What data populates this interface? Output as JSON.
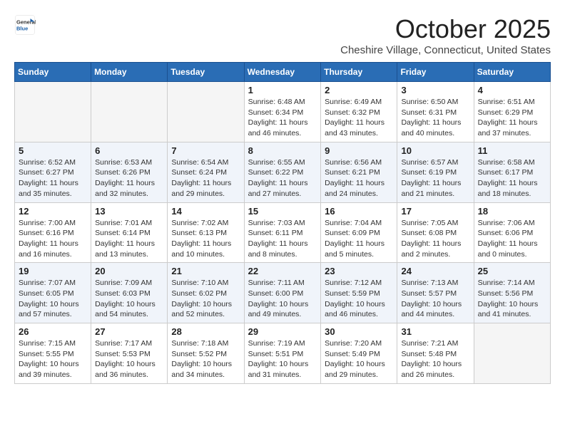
{
  "logo": {
    "line1": "General",
    "line2": "Blue"
  },
  "title": "October 2025",
  "subtitle": "Cheshire Village, Connecticut, United States",
  "days_of_week": [
    "Sunday",
    "Monday",
    "Tuesday",
    "Wednesday",
    "Thursday",
    "Friday",
    "Saturday"
  ],
  "weeks": [
    [
      {
        "day": "",
        "info": ""
      },
      {
        "day": "",
        "info": ""
      },
      {
        "day": "",
        "info": ""
      },
      {
        "day": "1",
        "info": "Sunrise: 6:48 AM\nSunset: 6:34 PM\nDaylight: 11 hours\nand 46 minutes."
      },
      {
        "day": "2",
        "info": "Sunrise: 6:49 AM\nSunset: 6:32 PM\nDaylight: 11 hours\nand 43 minutes."
      },
      {
        "day": "3",
        "info": "Sunrise: 6:50 AM\nSunset: 6:31 PM\nDaylight: 11 hours\nand 40 minutes."
      },
      {
        "day": "4",
        "info": "Sunrise: 6:51 AM\nSunset: 6:29 PM\nDaylight: 11 hours\nand 37 minutes."
      }
    ],
    [
      {
        "day": "5",
        "info": "Sunrise: 6:52 AM\nSunset: 6:27 PM\nDaylight: 11 hours\nand 35 minutes."
      },
      {
        "day": "6",
        "info": "Sunrise: 6:53 AM\nSunset: 6:26 PM\nDaylight: 11 hours\nand 32 minutes."
      },
      {
        "day": "7",
        "info": "Sunrise: 6:54 AM\nSunset: 6:24 PM\nDaylight: 11 hours\nand 29 minutes."
      },
      {
        "day": "8",
        "info": "Sunrise: 6:55 AM\nSunset: 6:22 PM\nDaylight: 11 hours\nand 27 minutes."
      },
      {
        "day": "9",
        "info": "Sunrise: 6:56 AM\nSunset: 6:21 PM\nDaylight: 11 hours\nand 24 minutes."
      },
      {
        "day": "10",
        "info": "Sunrise: 6:57 AM\nSunset: 6:19 PM\nDaylight: 11 hours\nand 21 minutes."
      },
      {
        "day": "11",
        "info": "Sunrise: 6:58 AM\nSunset: 6:17 PM\nDaylight: 11 hours\nand 18 minutes."
      }
    ],
    [
      {
        "day": "12",
        "info": "Sunrise: 7:00 AM\nSunset: 6:16 PM\nDaylight: 11 hours\nand 16 minutes."
      },
      {
        "day": "13",
        "info": "Sunrise: 7:01 AM\nSunset: 6:14 PM\nDaylight: 11 hours\nand 13 minutes."
      },
      {
        "day": "14",
        "info": "Sunrise: 7:02 AM\nSunset: 6:13 PM\nDaylight: 11 hours\nand 10 minutes."
      },
      {
        "day": "15",
        "info": "Sunrise: 7:03 AM\nSunset: 6:11 PM\nDaylight: 11 hours\nand 8 minutes."
      },
      {
        "day": "16",
        "info": "Sunrise: 7:04 AM\nSunset: 6:09 PM\nDaylight: 11 hours\nand 5 minutes."
      },
      {
        "day": "17",
        "info": "Sunrise: 7:05 AM\nSunset: 6:08 PM\nDaylight: 11 hours\nand 2 minutes."
      },
      {
        "day": "18",
        "info": "Sunrise: 7:06 AM\nSunset: 6:06 PM\nDaylight: 11 hours\nand 0 minutes."
      }
    ],
    [
      {
        "day": "19",
        "info": "Sunrise: 7:07 AM\nSunset: 6:05 PM\nDaylight: 10 hours\nand 57 minutes."
      },
      {
        "day": "20",
        "info": "Sunrise: 7:09 AM\nSunset: 6:03 PM\nDaylight: 10 hours\nand 54 minutes."
      },
      {
        "day": "21",
        "info": "Sunrise: 7:10 AM\nSunset: 6:02 PM\nDaylight: 10 hours\nand 52 minutes."
      },
      {
        "day": "22",
        "info": "Sunrise: 7:11 AM\nSunset: 6:00 PM\nDaylight: 10 hours\nand 49 minutes."
      },
      {
        "day": "23",
        "info": "Sunrise: 7:12 AM\nSunset: 5:59 PM\nDaylight: 10 hours\nand 46 minutes."
      },
      {
        "day": "24",
        "info": "Sunrise: 7:13 AM\nSunset: 5:57 PM\nDaylight: 10 hours\nand 44 minutes."
      },
      {
        "day": "25",
        "info": "Sunrise: 7:14 AM\nSunset: 5:56 PM\nDaylight: 10 hours\nand 41 minutes."
      }
    ],
    [
      {
        "day": "26",
        "info": "Sunrise: 7:15 AM\nSunset: 5:55 PM\nDaylight: 10 hours\nand 39 minutes."
      },
      {
        "day": "27",
        "info": "Sunrise: 7:17 AM\nSunset: 5:53 PM\nDaylight: 10 hours\nand 36 minutes."
      },
      {
        "day": "28",
        "info": "Sunrise: 7:18 AM\nSunset: 5:52 PM\nDaylight: 10 hours\nand 34 minutes."
      },
      {
        "day": "29",
        "info": "Sunrise: 7:19 AM\nSunset: 5:51 PM\nDaylight: 10 hours\nand 31 minutes."
      },
      {
        "day": "30",
        "info": "Sunrise: 7:20 AM\nSunset: 5:49 PM\nDaylight: 10 hours\nand 29 minutes."
      },
      {
        "day": "31",
        "info": "Sunrise: 7:21 AM\nSunset: 5:48 PM\nDaylight: 10 hours\nand 26 minutes."
      },
      {
        "day": "",
        "info": ""
      }
    ]
  ]
}
